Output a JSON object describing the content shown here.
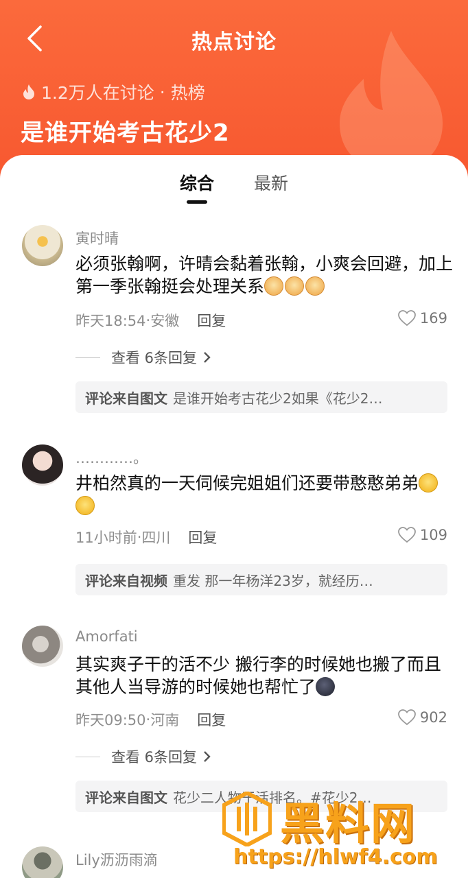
{
  "header": {
    "title": "热点讨论",
    "discussion_count": "1.2万人在讨论",
    "separator": "·",
    "rank_label": "热榜",
    "topic": "是谁开始考古花少2"
  },
  "tabs": [
    {
      "label": "综合",
      "active": true
    },
    {
      "label": "最新",
      "active": false
    }
  ],
  "comments": [
    {
      "username": "寅时晴",
      "text": "必须张翰啊，许晴会黏着张翰，小爽会回避，加上第一季张翰挺会处理关系",
      "emoji_count": 3,
      "time": "昨天18:54",
      "location": "安徽",
      "reply_label": "回复",
      "likes": "169",
      "view_replies": "查看 6条回复",
      "source_label": "评论来自图文",
      "source_text": "是谁开始考古花少2如果《花少2…"
    },
    {
      "username": "…………。",
      "text": "井柏然真的一天伺候完姐姐们还要带憨憨弟弟",
      "emoji_count": 2,
      "time": "11小时前",
      "location": "四川",
      "reply_label": "回复",
      "likes": "109",
      "source_label": "评论来自视频",
      "source_text": "重发 那一年杨洋23岁，就经历…"
    },
    {
      "username": "Amorfati",
      "text": "其实爽子干的活不少 搬行李的时候她也搬了而且其他人当导游的时候她也帮忙了",
      "emoji_count": 1,
      "time": "昨天09:50",
      "location": "河南",
      "reply_label": "回复",
      "likes": "902",
      "view_replies": "查看 6条回复",
      "source_label": "评论来自图文",
      "source_text": "花少二人物干活排名。#花少2…"
    },
    {
      "username": "Lily沥沥雨滴"
    }
  ],
  "watermark": {
    "name": "黑料网",
    "url": "https://hlwf4.com"
  },
  "colors": {
    "header_orange": "#f7572f",
    "watermark_orange": "#f7a21b"
  }
}
